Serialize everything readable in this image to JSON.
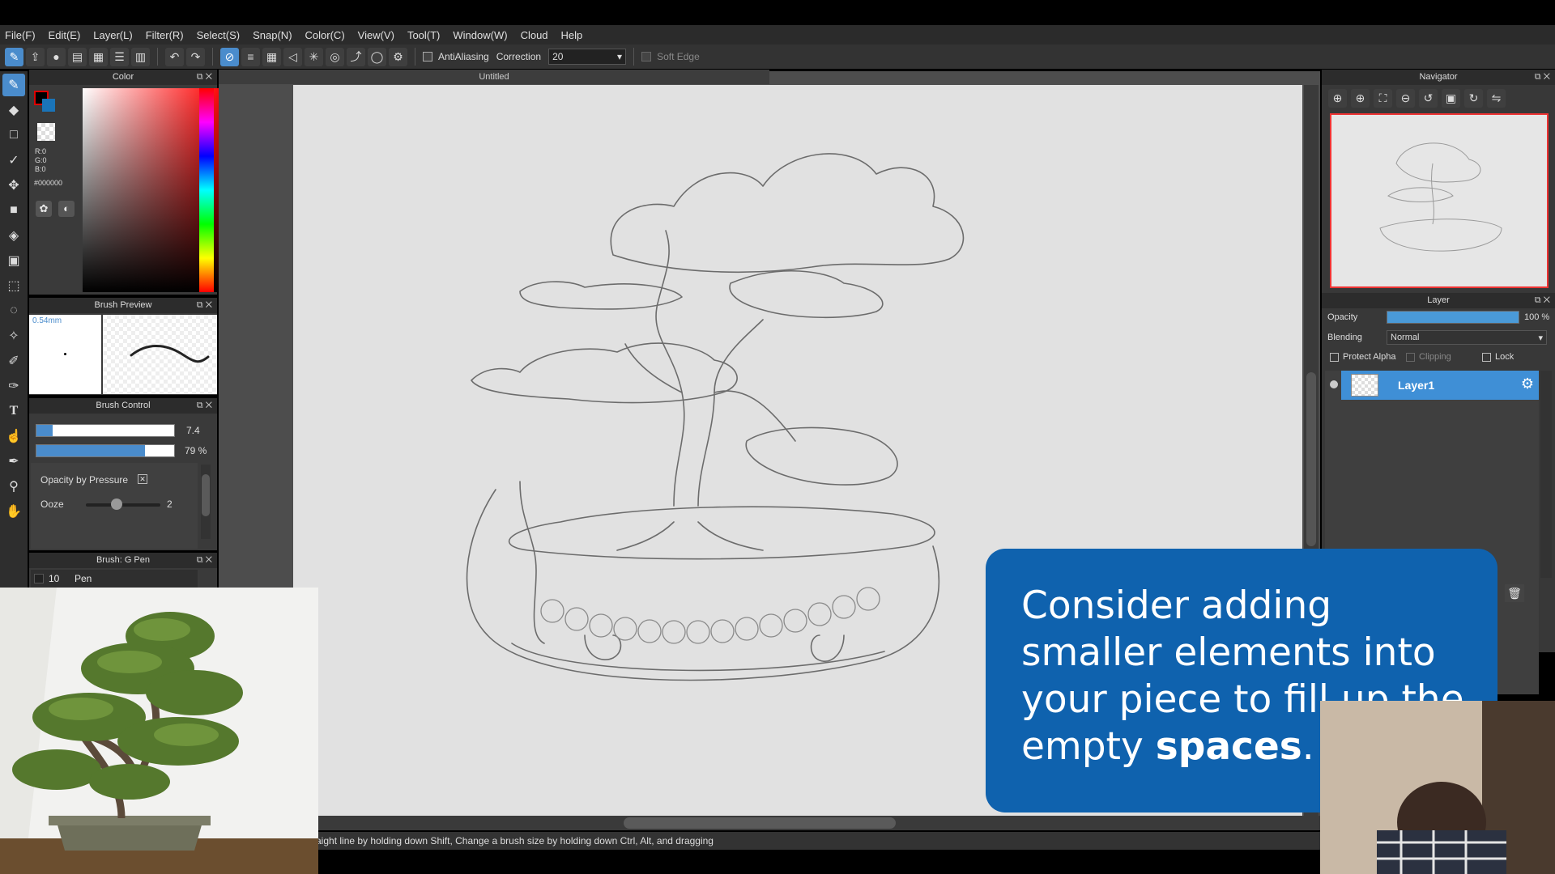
{
  "menu": [
    "File(F)",
    "Edit(E)",
    "Layer(L)",
    "Filter(R)",
    "Select(S)",
    "Snap(N)",
    "Color(C)",
    "View(V)",
    "Tool(T)",
    "Window(W)",
    "Cloud",
    "Help"
  ],
  "toolbar": {
    "antialiasing_label": "AntiAliasing",
    "correction_label": "Correction",
    "correction_value": "20",
    "soft_edge_label": "Soft Edge"
  },
  "color_panel": {
    "title": "Color",
    "r": "R:0",
    "g": "G:0",
    "b": "B:0",
    "hex": "#000000",
    "primary_color": "#000000",
    "secondary_color": "#1a74b8"
  },
  "brush_preview": {
    "title": "Brush Preview",
    "size_label": "0.54mm"
  },
  "brush_control": {
    "title": "Brush Control",
    "size_value": "7.4",
    "size_fraction": 0.12,
    "opacity_value": "79 %",
    "opacity_fraction": 0.79,
    "opacity_by_pressure_label": "Opacity by Pressure",
    "ooze_label": "Ooze",
    "ooze_value": "2"
  },
  "brush_list": {
    "title": "Brush: G Pen",
    "item_size": "10",
    "item_name": "Pen"
  },
  "document": {
    "tab_title": "Untitled"
  },
  "status": {
    "hint": "aight line by holding down Shift, Change a brush size by holding down Ctrl, Alt, and dragging"
  },
  "navigator": {
    "title": "Navigator"
  },
  "layer_panel": {
    "title": "Layer",
    "opacity_label": "Opacity",
    "opacity_value": "100 %",
    "opacity_fraction": 1.0,
    "blending_label": "Blending",
    "blending_value": "Normal",
    "protect_alpha_label": "Protect Alpha",
    "clipping_label": "Clipping",
    "lock_label": "Lock",
    "layers": [
      {
        "name": "Layer1"
      }
    ]
  },
  "tip": {
    "text_before": "Consider adding smaller elements into your piece to fill up the empty ",
    "text_bold": "spaces",
    "text_after": "."
  },
  "accent_color": "#4a8ccc",
  "tip_color": "#0f62ae"
}
